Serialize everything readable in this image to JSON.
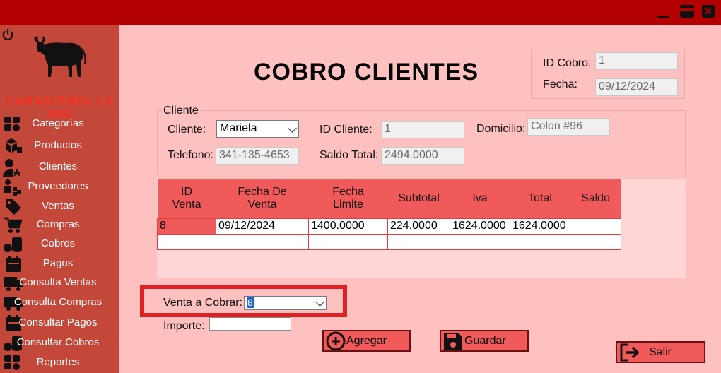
{
  "window": {
    "min_label": "minimize",
    "max_label": "maximize",
    "close_label": "close"
  },
  "sidebar": {
    "brand": "CARNICERÍA LA XVI",
    "items": [
      {
        "label": "Categorías",
        "icon": "grid-icon"
      },
      {
        "label": "Productos",
        "icon": "boxes-icon"
      },
      {
        "label": "Clientes",
        "icon": "user-star-icon"
      },
      {
        "label": "Proveedores",
        "icon": "supplier-icon"
      },
      {
        "label": "Ventas",
        "icon": "tag-icon"
      },
      {
        "label": "Compras",
        "icon": "cart-icon"
      },
      {
        "label": "Cobros",
        "icon": "coins-icon"
      },
      {
        "label": "Pagos",
        "icon": "calendar-icon"
      },
      {
        "label": "Consulta Ventas",
        "icon": "truck-icon"
      },
      {
        "label": "Consulta Compras",
        "icon": "truck-icon"
      },
      {
        "label": "Consultar Pagos",
        "icon": "calendar-icon"
      },
      {
        "label": "Consultar Cobros",
        "icon": "coins-icon"
      },
      {
        "label": "Reportes",
        "icon": "grid-icon"
      }
    ]
  },
  "header": {
    "title": "COBRO CLIENTES",
    "id_cobro_label": "ID Cobro:",
    "id_cobro_value": "1",
    "fecha_label": "Fecha:",
    "fecha_value": "09/12/2024"
  },
  "cliente_group": {
    "legend": "Cliente",
    "cliente_label": "Cliente:",
    "cliente_value": "Mariela",
    "id_cliente_label": "ID Cliente:",
    "id_cliente_value": "1____",
    "domicilio_label": "Domicilio:",
    "domicilio_value": "Colon #96",
    "telefono_label": "Telefono:",
    "telefono_value": "341-135-4653",
    "saldo_label": "Saldo Total:",
    "saldo_value": "2494.0000"
  },
  "table": {
    "columns": [
      {
        "line1": "ID",
        "line2": "Venta"
      },
      {
        "line1": "Fecha De",
        "line2": "Venta"
      },
      {
        "line1": "Fecha",
        "line2": "Limite"
      },
      {
        "line1": "Subtotal",
        "line2": ""
      },
      {
        "line1": "Iva",
        "line2": ""
      },
      {
        "line1": "Total",
        "line2": ""
      },
      {
        "line1": "Saldo",
        "line2": ""
      }
    ],
    "rows": [
      [
        "8",
        "09/12/2024",
        "1400.0000",
        "224.0000",
        "1624.0000",
        "1624.0000",
        ""
      ],
      [
        "",
        "",
        "",
        "",
        "",
        "",
        ""
      ]
    ]
  },
  "form": {
    "venta_label": "Venta a Cobrar:",
    "venta_value": "8",
    "importe_label": "Importe:",
    "importe_value": ""
  },
  "buttons": {
    "agregar": "Agregar",
    "guardar": "Guardar",
    "salir": "Salir"
  },
  "colors": {
    "titlebar": "#b30000",
    "sidebar": "#c4483a",
    "background": "#ffc0c0",
    "accent": "#f05a5a",
    "highlight": "#e02020"
  }
}
